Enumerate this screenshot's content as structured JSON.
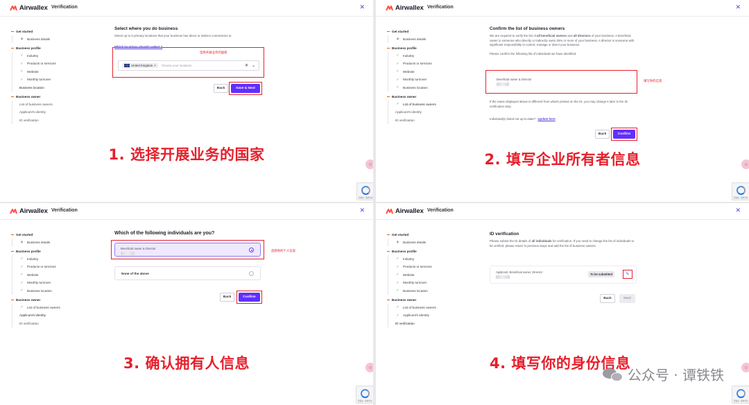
{
  "brand": {
    "logo_text": "Airwallex",
    "app_title": "Verification",
    "accent": "#612fff",
    "annotation_color": "#e5202c"
  },
  "sidebar": {
    "sections": [
      {
        "title": "Get started",
        "items": [
          {
            "label": "Business details",
            "icon": "lock-icon"
          }
        ]
      },
      {
        "title": "Business profile",
        "items": [
          {
            "label": "Industry"
          },
          {
            "label": "Products or services"
          },
          {
            "label": "Website"
          },
          {
            "label": "Monthly turnover"
          },
          {
            "label": "Business location"
          }
        ]
      },
      {
        "title": "Business owner",
        "items": [
          {
            "label": "List of business owners"
          },
          {
            "label": "Applicant's identity"
          },
          {
            "label": "ID verification"
          }
        ]
      }
    ]
  },
  "step1": {
    "title": "Select where you do business",
    "desc": "Select up to 5 primary locations that your business has direct or indirect connections to",
    "link": "Which locations should I select ?",
    "chip": "United Kingdom",
    "placeholder": "Choose your locations",
    "note": "选择开展业务的国家",
    "back": "Back",
    "next": "Save & Next",
    "caption": "1. 选择开展业务的国家"
  },
  "step2": {
    "title": "Confirm the list of business owners",
    "desc_a": "We are required to verify the list of",
    "desc_b": "all beneficial owners",
    "desc_c": "and",
    "desc_d": "all directors",
    "desc_e": "of your business. A beneficial owner is someone who directly or indirectly owns 25% or more of your business. A director is someone with significant responsibility to control, manage or direct your business.",
    "confirm_text": "Please confirm the following list of individuals we have identified.",
    "role": "Beneficial owner & Director",
    "note": "填写你的信息",
    "id_note": "If the name displayed above is different from what's printed on the ID, you may change it later in the ID verification step.",
    "outdated": "Individual(s) listed not up-to-date?",
    "update": "Update here",
    "back": "Back",
    "confirm": "Confirm",
    "caption": "2. 填写企业所有者信息"
  },
  "step3": {
    "title": "Which of the following individuals are you?",
    "role": "Beneficial owner & Director",
    "none": "None of the above",
    "note": "选择你的个人信息",
    "back": "Back",
    "confirm": "Confirm",
    "caption": "3. 确认拥有人信息"
  },
  "step4": {
    "title": "ID verification",
    "desc_a": "Please submit the ID details of",
    "desc_b": "all individuals",
    "desc_c": "for verification. If you need to change the list of individuals to be verified, please return to previous steps and add the list of business owners.",
    "role": "Applicant, Beneficial owner, Director",
    "status": "To be submitted",
    "back": "Back",
    "next": "Next",
    "caption": "4. 填写你的身份信息"
  },
  "recaptcha_text": "隐私权 - 使用条款",
  "watermark": "公众号 · 谭铁铁"
}
